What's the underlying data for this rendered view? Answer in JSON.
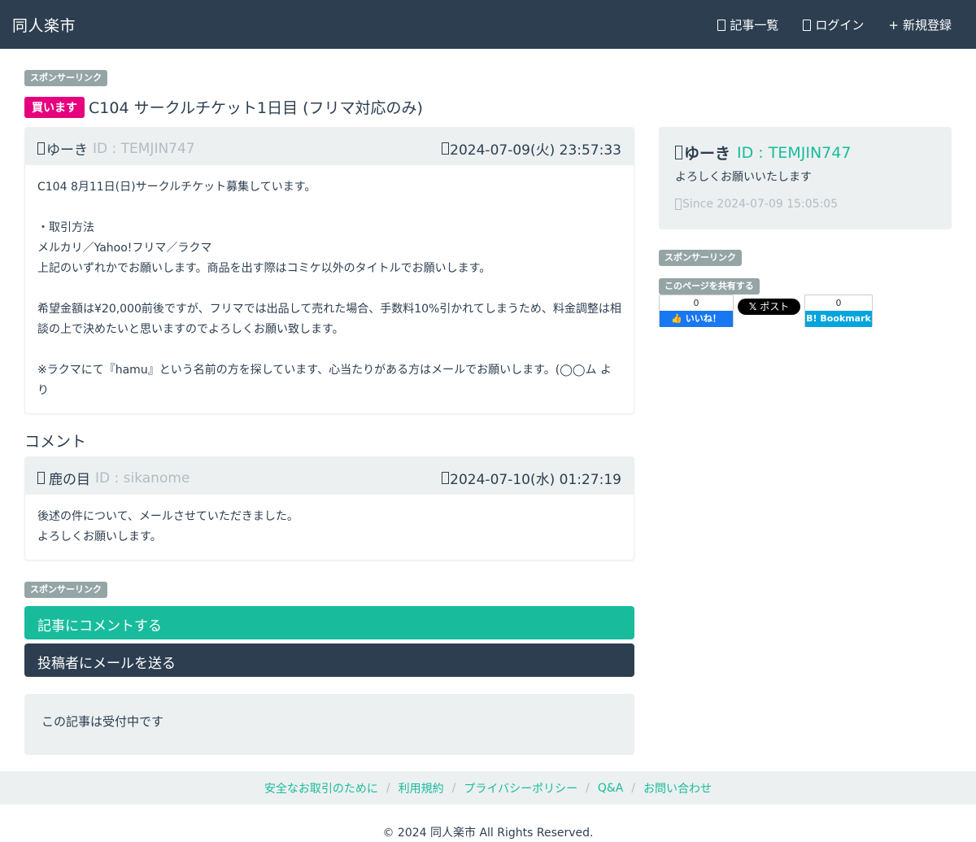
{
  "navbar": {
    "brand": "同人楽市",
    "links": [
      {
        "label": "記事一覧",
        "icon": "list-icon"
      },
      {
        "label": "ログイン",
        "icon": "login-icon"
      },
      {
        "label": "新規登録",
        "icon": "plus-icon",
        "prefix": "+"
      }
    ]
  },
  "sponsor_label": "スポンサーリンク",
  "post": {
    "type_badge": "買います",
    "title": "C104 サークルチケット1日目 (フリマ対応のみ)",
    "author_name": "ゆーき",
    "author_id": "ID : TEMJIN747",
    "datetime": "2024-07-09(火) 23:57:33",
    "body": "C104 8月11日(日)サークルチケット募集しています。\n\n・取引方法\nメルカリ／Yahoo!フリマ／ラクマ\n上記のいずれかでお願いします。商品を出す際はコミケ以外のタイトルでお願いします。\n\n希望金額は¥20,000前後ですが、フリマでは出品して売れた場合、手数料10%引かれてしまうため、料金調整は相談の上で決めたいと思いますのでよろしくお願い致します。\n\n※ラクマにて『hamu』という名前の方を探しています、心当たりがある方はメールでお願いします。(◯◯ム より"
  },
  "comments": {
    "heading": "コメント",
    "items": [
      {
        "author_name": "鹿の目",
        "author_id": "ID : sikanome",
        "datetime": "2024-07-10(水) 01:27:19",
        "body": "後述の件について、メールさせていただきました。\nよろしくお願いします。"
      }
    ]
  },
  "actions": {
    "comment_button": "記事にコメントする",
    "mail_button": "投稿者にメールを送る"
  },
  "status_text": "この記事は受付中です",
  "profile": {
    "name": "ゆーき",
    "id": "ID : TEMJIN747",
    "message": "よろしくお願いいたします",
    "since": "Since 2024-07-09 15:05:05"
  },
  "share": {
    "label": "このページを共有する",
    "facebook": {
      "count": "0",
      "like_label": "いいね！"
    },
    "x": {
      "label": "ポスト"
    },
    "hatena": {
      "count": "0",
      "label": "Bookmark"
    }
  },
  "footer": {
    "links": [
      "安全なお取引のために",
      "利用規約",
      "プライバシーポリシー",
      "Q&A",
      "お問い合わせ"
    ],
    "separator": "/",
    "copyright": "© 2024 同人楽市 All Rights Reserved."
  },
  "colors": {
    "primary": "#2c3e50",
    "success": "#18bc9c",
    "buy_badge": "#e6007e",
    "light": "#ecf0f1",
    "muted": "#b4bcc2"
  }
}
